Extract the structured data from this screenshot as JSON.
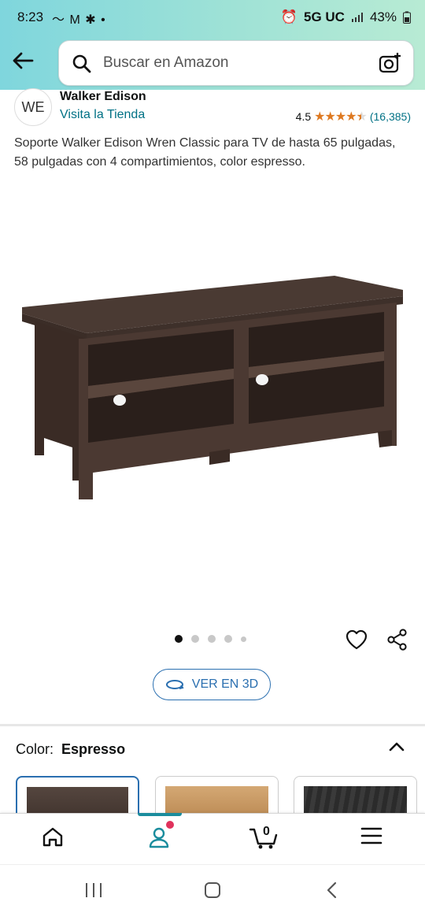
{
  "status_bar": {
    "time": "8:23",
    "left_icons": "〜 M ✱ •",
    "network": "5G UC",
    "battery": "43%"
  },
  "search": {
    "placeholder": "Buscar en Amazon"
  },
  "brand": {
    "logo_text": "WE",
    "name": "Walker Edison",
    "store_link": "Visita la Tienda"
  },
  "rating": {
    "value": "4.5",
    "stars": 4.5,
    "count": "(16,385)"
  },
  "product": {
    "title": "Soporte Walker Edison Wren Classic para TV de hasta 65 pulgadas, 58 pulgadas con 4 compartimientos, color espresso.",
    "image_alt": "TV stand espresso",
    "carousel": {
      "total": 5,
      "active": 1
    }
  },
  "view_3d": {
    "label": "VER EN 3D"
  },
  "color_selector": {
    "label": "Color:",
    "selected": "Espresso",
    "options": [
      {
        "name": "Espresso",
        "color": "#5a4a42"
      },
      {
        "name": "Oak",
        "color": "#c69a68"
      },
      {
        "name": "Black",
        "color": "#3a3a3a"
      }
    ]
  },
  "bottom_nav": {
    "cart_count": "0",
    "active": "account"
  },
  "colors": {
    "accent": "#2a6fb0",
    "link": "#007185",
    "star": "#de7921",
    "nav_active": "#1a8c9d",
    "notify_dot": "#e0325c"
  }
}
